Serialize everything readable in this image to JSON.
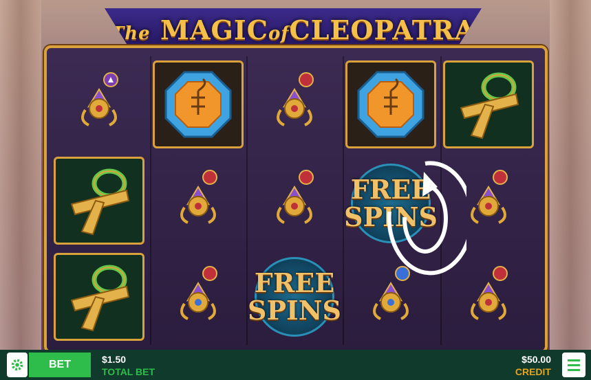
{
  "game": {
    "title_prefix": "The",
    "title_main": "MAGIC",
    "title_of": "of",
    "title_end": "CLEOPATRA"
  },
  "reels": [
    [
      "scarab",
      "ankh",
      "ankh"
    ],
    [
      "gem-scorpion",
      "scarab",
      "scarab"
    ],
    [
      "scarab",
      "scarab",
      "free-spins"
    ],
    [
      "gem-scorpion",
      "free-spins",
      "scarab"
    ],
    [
      "ankh",
      "scarab",
      "scarab"
    ]
  ],
  "free_spins": {
    "line1": "FREE",
    "line2": "SPINS"
  },
  "bottom_bar": {
    "bet_label": "BET",
    "total_bet_value": "$1.50",
    "total_bet_label": "TOTAL BET",
    "credit_value": "$50.00",
    "credit_label": "CREDIT"
  },
  "colors": {
    "accent_green": "#2ebd4a",
    "gold": "#d9a23c",
    "credit_label": "#e3a41e",
    "bar_bg": "#103a2c"
  },
  "icons": [
    "gear-icon",
    "menu-icon",
    "spin-icon",
    "scarab-icon",
    "ankh-icon",
    "scorpion-gem-icon"
  ]
}
